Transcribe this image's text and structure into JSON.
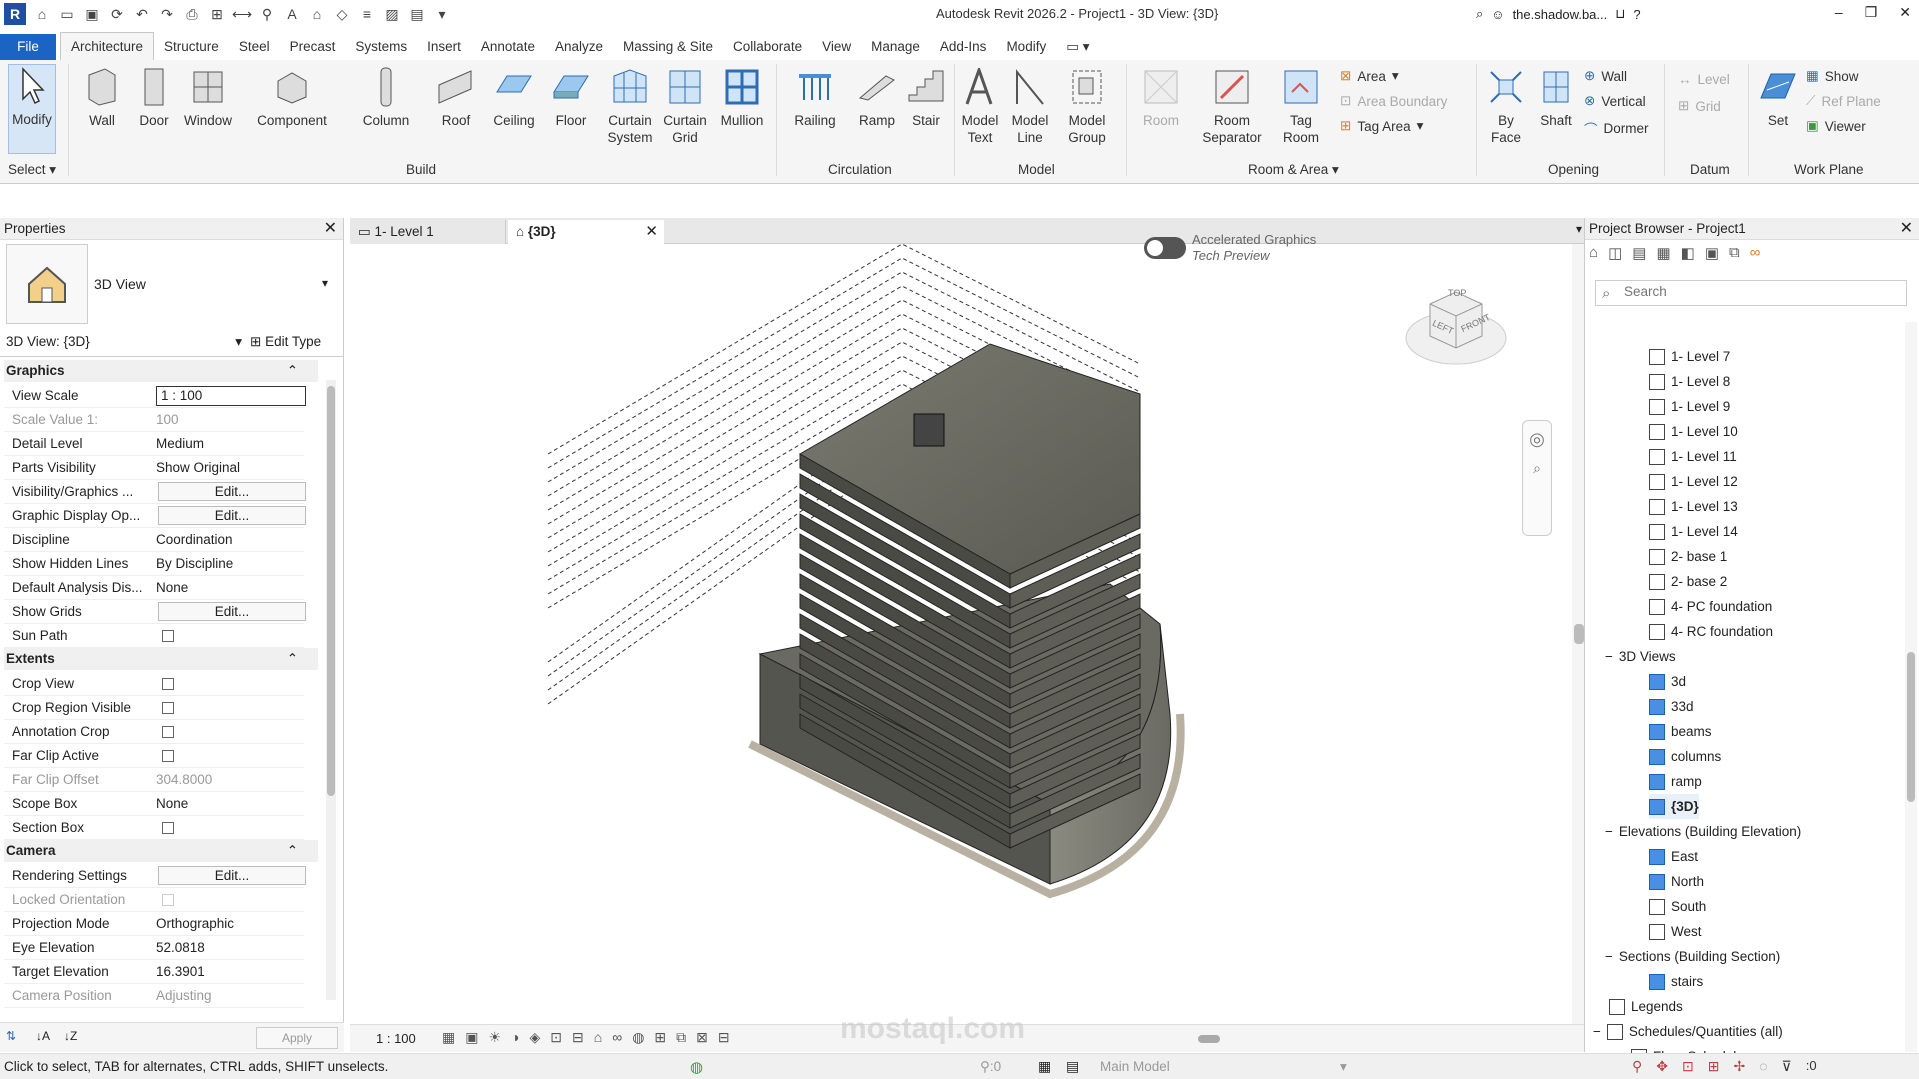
{
  "app": {
    "title": "Autodesk Revit 2026.2 - Project1 - 3D View: {3D}",
    "user": "the.shadow.ba...",
    "logo": "R"
  },
  "menu": {
    "file": "File",
    "tabs": [
      "Architecture",
      "Structure",
      "Steel",
      "Precast",
      "Systems",
      "Insert",
      "Annotate",
      "Analyze",
      "Massing & Site",
      "Collaborate",
      "View",
      "Manage",
      "Add-Ins",
      "Modify"
    ]
  },
  "ribbon": {
    "modify": "Modify",
    "select": "Select",
    "build": {
      "wall": "Wall",
      "door": "Door",
      "window": "Window",
      "component": "Component",
      "column": "Column",
      "roof": "Roof",
      "ceiling": "Ceiling",
      "floor": "Floor",
      "curtain_system": "Curtain System",
      "curtain_grid": "Curtain Grid",
      "mullion": "Mullion",
      "group": "Build"
    },
    "circulation": {
      "railing": "Railing",
      "ramp": "Ramp",
      "stair": "Stair",
      "group": "Circulation"
    },
    "model": {
      "text": "Model Text",
      "line": "Model Line",
      "group_btn": "Model Group",
      "group": "Model"
    },
    "room": {
      "room": "Room",
      "separator": "Room Separator",
      "tag_room": "Tag Room",
      "area": "Area",
      "area_boundary": "Area  Boundary",
      "tag_area": "Tag  Area",
      "group": "Room & Area"
    },
    "opening": {
      "by_face": "By Face",
      "shaft": "Shaft",
      "wall": "Wall",
      "vertical": "Vertical",
      "dormer": "Dormer",
      "group": "Opening"
    },
    "datum": {
      "level": "Level",
      "grid": "Grid",
      "group": "Datum"
    },
    "workplane": {
      "set": "Set",
      "show": "Show",
      "ref_plane": "Ref  Plane",
      "viewer": "Viewer",
      "group": "Work Plane"
    }
  },
  "properties": {
    "title": "Properties",
    "type": "3D View",
    "instance": "3D View: {3D}",
    "edit_type": "Edit Type",
    "apply": "Apply",
    "sections": {
      "graphics": "Graphics",
      "extents": "Extents",
      "camera": "Camera"
    },
    "graphics": [
      {
        "k": "View Scale",
        "v": "1 : 100"
      },
      {
        "k": "Scale Value    1:",
        "v": "100"
      },
      {
        "k": "Detail Level",
        "v": "Medium"
      },
      {
        "k": "Parts Visibility",
        "v": "Show Original"
      },
      {
        "k": "Visibility/Graphics ...",
        "v": "Edit..."
      },
      {
        "k": "Graphic Display Op...",
        "v": "Edit..."
      },
      {
        "k": "Discipline",
        "v": "Coordination"
      },
      {
        "k": "Show Hidden Lines",
        "v": "By Discipline"
      },
      {
        "k": "Default Analysis Dis...",
        "v": "None"
      },
      {
        "k": "Show Grids",
        "v": "Edit..."
      },
      {
        "k": "Sun Path",
        "v": ""
      }
    ],
    "extents": [
      {
        "k": "Crop View",
        "v": ""
      },
      {
        "k": "Crop Region Visible",
        "v": ""
      },
      {
        "k": "Annotation Crop",
        "v": ""
      },
      {
        "k": "Far Clip Active",
        "v": ""
      },
      {
        "k": "Far Clip Offset",
        "v": "304.8000"
      },
      {
        "k": "Scope Box",
        "v": "None"
      },
      {
        "k": "Section Box",
        "v": ""
      }
    ],
    "camera": [
      {
        "k": "Rendering Settings",
        "v": "Edit..."
      },
      {
        "k": "Locked Orientation",
        "v": ""
      },
      {
        "k": "Projection Mode",
        "v": "Orthographic"
      },
      {
        "k": "Eye Elevation",
        "v": "52.0818"
      },
      {
        "k": "Target Elevation",
        "v": "16.3901"
      },
      {
        "k": "Camera Position",
        "v": "Adjusting"
      }
    ]
  },
  "view": {
    "tab1": "1- Level 1",
    "tab2": "{3D}",
    "accel": "Accelerated Graphics",
    "accel2": "Tech Preview",
    "scale": "1 : 100",
    "cube": {
      "top": "TOP",
      "left": "LEFT",
      "front": "FRONT"
    }
  },
  "browser": {
    "title": "Project Browser - Project1",
    "search": "Search",
    "levels": [
      "1- Level 7",
      "1- Level 8",
      "1- Level 9",
      "1- Level 10",
      "1- Level 11",
      "1- Level 12",
      "1- Level 13",
      "1- Level 14",
      "2- base 1",
      "2- base 2",
      "4- PC foundation",
      "4- RC foundation"
    ],
    "views3d": "3D Views",
    "v3d": [
      "3d",
      "33d",
      "beams",
      "columns",
      "ramp",
      "{3D}"
    ],
    "elev": "Elevations (Building Elevation)",
    "elevs": [
      "East",
      "North",
      "South",
      "West"
    ],
    "sections": "Sections (Building Section)",
    "sects": [
      "stairs"
    ],
    "legends": "Legends",
    "schedules": "Schedules/Quantities (all)",
    "floor_schedule": "Floor Schedule"
  },
  "status": {
    "hint": "Click to select, TAB for alternates, CTRL adds, SHIFT unselects.",
    "model": "Main Model",
    "zero1": ":0",
    "zero2": ":0"
  },
  "watermark": "mostaql.com"
}
